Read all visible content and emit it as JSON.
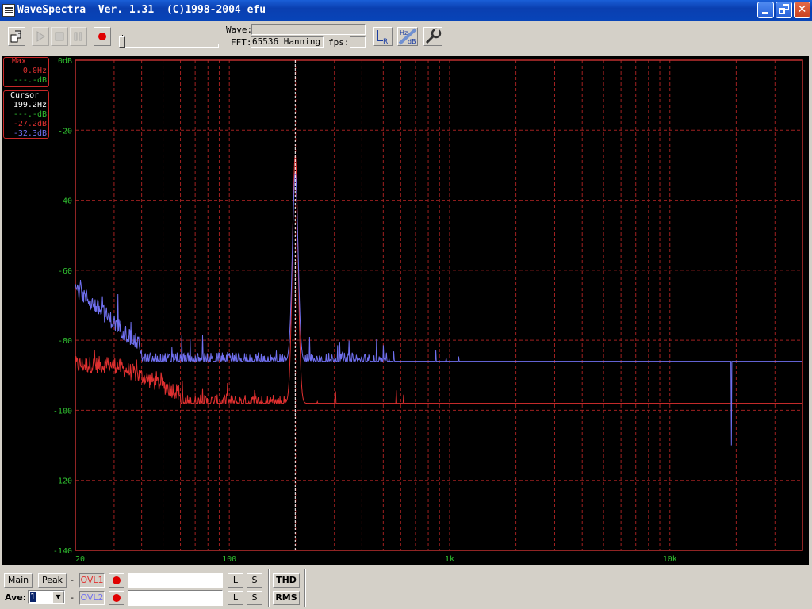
{
  "window": {
    "title": "WaveSpectra  Ver. 1.31  (C)1998-2004 efu"
  },
  "toolbar": {
    "wave_label": "Wave:",
    "wave_value": "",
    "fft_label": "FFT:",
    "fft_value": "65536 Hanning",
    "fps_label": "fps:",
    "fps_value": ""
  },
  "plot": {
    "top_label": "0dB",
    "y_ticks": [
      "-20",
      "-40",
      "-60",
      "-80",
      "-100",
      "-120",
      "-140"
    ],
    "x_ticks": [
      "20",
      "100",
      "1k",
      "10k"
    ],
    "cursor_freq_hz": 199.2,
    "colors": {
      "grid": "#a02020",
      "left": "#e03030",
      "right": "#7070f0",
      "axis_text": "#30c030"
    }
  },
  "max_box": {
    "title": "Max",
    "freq": "0.0Hz",
    "db": "---.-dB"
  },
  "cursor_box": {
    "title": "Cursor",
    "freq": "199.2Hz",
    "db": "---.-dB",
    "left_db": "-27.2dB",
    "right_db": "-32.3dB"
  },
  "bottom": {
    "main_label": "Main",
    "peak_label": "Peak",
    "ave_label": "Ave:",
    "ave_value": "1",
    "dash": "-",
    "ovl1": "OVL1",
    "ovl2": "OVL2",
    "l_label": "L",
    "s_label": "S",
    "thd_label": "THD",
    "rms_label": "RMS"
  }
}
